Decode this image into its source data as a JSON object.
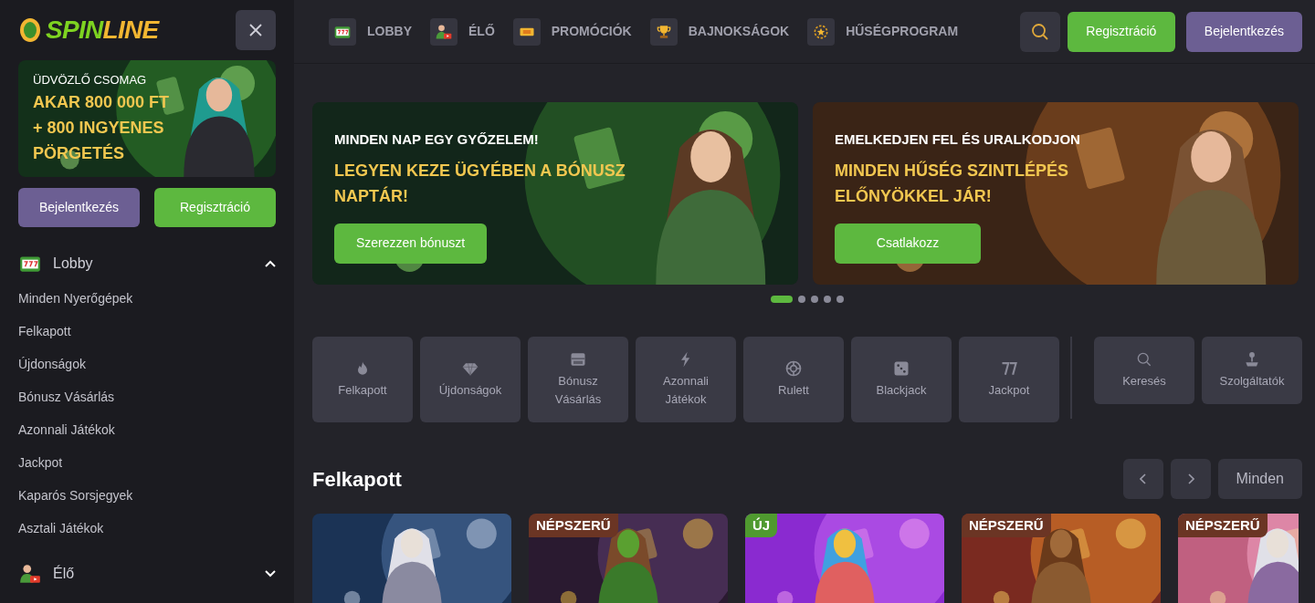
{
  "logo": {
    "part_1": "SPIN",
    "part_2": "LINE"
  },
  "sidebar": {
    "promo": {
      "eyebrow": "ÜDVÖZLŐ CSOMAG",
      "headline": "AKAR 800 000 FT + 800 INGYENES PÖRGETÉS"
    },
    "buttons": [
      {
        "label": "Bejelentkezés",
        "kind": "login"
      },
      {
        "label": "Regisztráció",
        "kind": "register"
      }
    ],
    "menu": [
      {
        "label": "Lobby",
        "kind": "slot",
        "expanded": true,
        "children": [
          {
            "label": "Minden Nyerőgépek"
          },
          {
            "label": "Felkapott"
          },
          {
            "label": "Újdonságok"
          },
          {
            "label": "Bónusz Vásárlás"
          },
          {
            "label": "Azonnali Játékok"
          },
          {
            "label": "Jackpot"
          },
          {
            "label": "Kaparós Sorsjegyek"
          },
          {
            "label": "Asztali Játékok"
          }
        ]
      },
      {
        "label": "Élő",
        "kind": "live",
        "expanded": false
      }
    ]
  },
  "nav": [
    {
      "label": "LOBBY",
      "kind": "slot"
    },
    {
      "label": "ÉLŐ",
      "kind": "live"
    },
    {
      "label": "PROMÓCIÓK",
      "kind": "ticket"
    },
    {
      "label": "BAJNOKSÁGOK",
      "kind": "trophy"
    },
    {
      "label": "HŰSÉGPROGRAM",
      "kind": "laurel"
    }
  ],
  "header_buttons": [
    {
      "label": "Regisztráció",
      "kind": "register"
    },
    {
      "label": "Bejelentkezés",
      "kind": "login"
    }
  ],
  "banners": [
    {
      "eyebrow": "MINDEN NAP EGY GYŐZELEM!",
      "title": "LEGYEN KEZE ÜGYÉBEN A BÓNUSZ NAPTÁR!",
      "button": "Szerezzen bónuszt"
    },
    {
      "eyebrow": "EMELKEDJEN FEL ÉS URALKODJON",
      "title": "MINDEN HŰSÉG SZINTLÉPÉS ELŐNYÖKKEL JÁR!",
      "button": "Csatlakozz"
    }
  ],
  "carousel_dots": [
    {
      "selected": true
    },
    {
      "selected": false
    },
    {
      "selected": false
    },
    {
      "selected": false
    },
    {
      "selected": false
    }
  ],
  "categories": [
    {
      "label": "Felkapott",
      "kind": "fire"
    },
    {
      "label": "Újdonságok",
      "kind": "diamond"
    },
    {
      "label": "Bónusz Vásárlás",
      "kind": "chest"
    },
    {
      "label": "Azonnali Játékok",
      "kind": "bolt"
    },
    {
      "label": "Rulett",
      "kind": "roulette"
    },
    {
      "label": "Blackjack",
      "kind": "dice"
    },
    {
      "label": "Jackpot",
      "kind": "sevens"
    }
  ],
  "tools": [
    {
      "label": "Keresés",
      "kind": "search"
    },
    {
      "label": "Szolgáltatók",
      "kind": "joystick"
    }
  ],
  "section": {
    "title": "Felkapott",
    "all_button": "Minden"
  },
  "games": [
    {
      "kind": "picture"
    },
    {
      "kind": "picture",
      "badge": {
        "text": "NÉPSZERŰ",
        "kind": "popular"
      }
    },
    {
      "kind": "picture",
      "badge": {
        "text": "ÚJ",
        "kind": "new"
      }
    },
    {
      "kind": "picture",
      "badge": {
        "text": "NÉPSZERŰ",
        "kind": "popular"
      }
    },
    {
      "kind": "picture",
      "badge": {
        "text": "NÉPSZERŰ",
        "kind": "popular"
      }
    }
  ]
}
